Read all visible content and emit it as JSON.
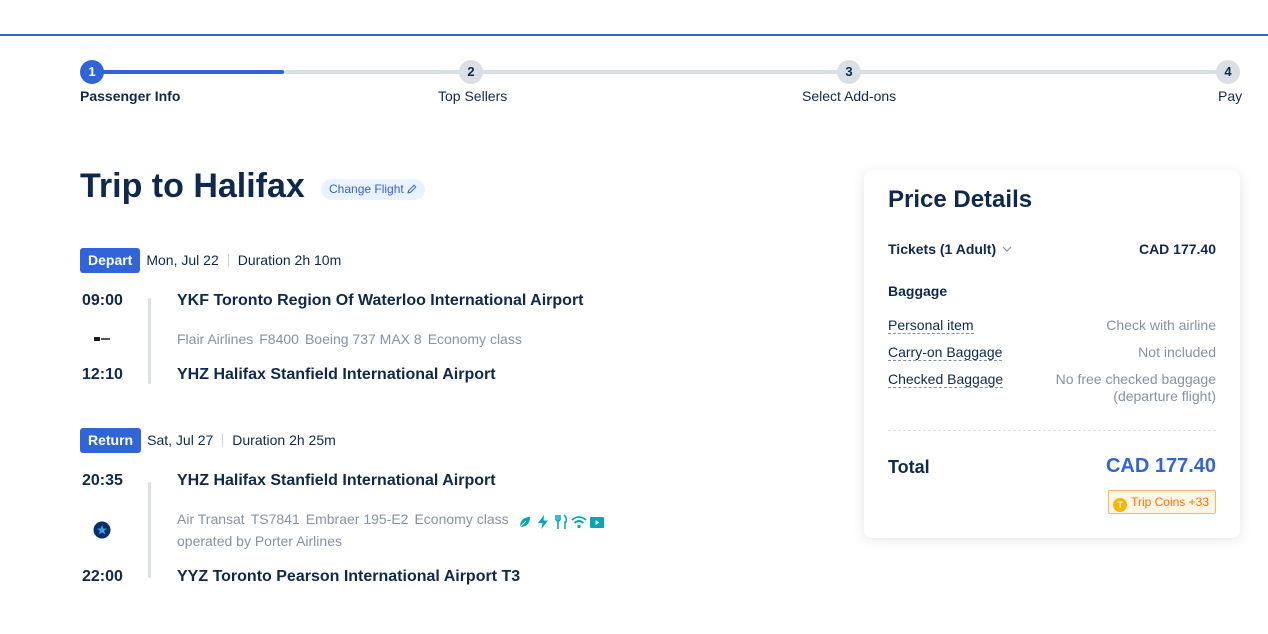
{
  "steps": [
    {
      "num": "1",
      "label": "Passenger Info"
    },
    {
      "num": "2",
      "label": "Top Sellers"
    },
    {
      "num": "3",
      "label": "Select Add-ons"
    },
    {
      "num": "4",
      "label": "Pay"
    }
  ],
  "progress_fraction": 0.17,
  "trip": {
    "title": "Trip to Halifax",
    "change_flight": "Change Flight"
  },
  "depart": {
    "badge": "Depart",
    "date": "Mon, Jul 22",
    "duration": "Duration 2h 10m",
    "dep_time": "09:00",
    "dep_airport": "YKF Toronto Region Of Waterloo International Airport",
    "airline": "Flair Airlines",
    "flight_no": "F8400",
    "aircraft": "Boeing 737 MAX 8",
    "cabin": "Economy class",
    "arr_time": "12:10",
    "arr_airport": "YHZ Halifax Stanfield International Airport"
  },
  "return": {
    "badge": "Return",
    "date": "Sat, Jul 27",
    "duration": "Duration 2h 25m",
    "dep_time": "20:35",
    "dep_airport": "YHZ Halifax Stanfield International Airport",
    "airline": "Air Transat",
    "flight_no": "TS7841",
    "aircraft": "Embraer 195-E2",
    "cabin": "Economy class",
    "amenities": [
      "leaf-icon",
      "power-icon",
      "meal-icon",
      "wifi-icon",
      "entertainment-icon"
    ],
    "operated_by": "operated by Porter Airlines",
    "arr_time": "22:00",
    "arr_airport": "YYZ Toronto Pearson International Airport T3"
  },
  "price": {
    "title": "Price Details",
    "tickets_label": "Tickets (1 Adult)",
    "tickets_value": "CAD 177.40",
    "baggage_head": "Baggage",
    "personal_item_label": "Personal item",
    "personal_item_value": "Check with airline",
    "carry_on_label": "Carry-on Baggage",
    "carry_on_value": "Not included",
    "checked_label": "Checked Baggage",
    "checked_value_1": "No free checked baggage",
    "checked_value_2": "(departure flight)",
    "total_label": "Total",
    "total_value": "CAD 177.40",
    "coins_label": "Trip Coins +33"
  },
  "colors": {
    "accent": "#3264d9",
    "text": "#0f294d",
    "muted": "#8592a6",
    "amenity": "#00a6b5",
    "coins": "#ff6f00"
  }
}
